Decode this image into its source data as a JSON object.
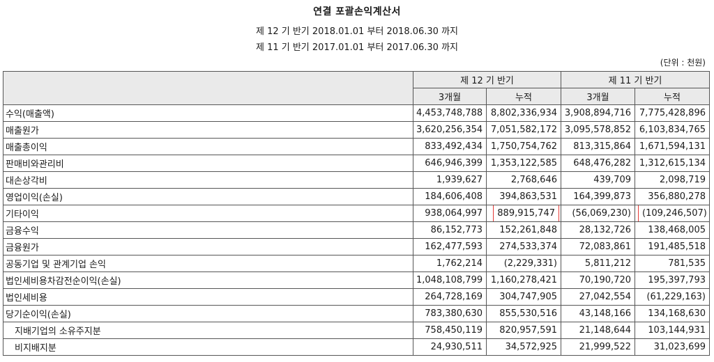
{
  "header": {
    "title": "연결 포괄손익계산서",
    "period_current": "제 12 기 반기 2018.01.01 부터 2018.06.30 까지",
    "period_prior": "제 11 기 반기 2017.01.01 부터 2017.06.30 까지",
    "unit": "(단위 : 천원)"
  },
  "table": {
    "col_groups": [
      "제 12 기 반기",
      "제 11 기 반기"
    ],
    "sub_cols": [
      "3개월",
      "누적",
      "3개월",
      "누적"
    ],
    "rows": [
      {
        "label": "수익(매출액)",
        "values": [
          "4,453,748,788",
          "8,802,336,934",
          "3,908,894,716",
          "7,775,428,896"
        ]
      },
      {
        "label": "매출원가",
        "values": [
          "3,620,256,354",
          "7,051,582,172",
          "3,095,578,852",
          "6,103,834,765"
        ]
      },
      {
        "label": "매출총이익",
        "values": [
          "833,492,434",
          "1,750,754,762",
          "813,315,864",
          "1,671,594,131"
        ]
      },
      {
        "label": "판매비와관리비",
        "values": [
          "646,946,399",
          "1,353,122,585",
          "648,476,282",
          "1,312,615,134"
        ]
      },
      {
        "label": "대손상각비",
        "values": [
          "1,939,627",
          "2,768,646",
          "439,709",
          "2,098,719"
        ]
      },
      {
        "label": "영업이익(손실)",
        "values": [
          "184,606,408",
          "394,863,531",
          "164,399,873",
          "356,880,278"
        ]
      },
      {
        "label": "기타이익",
        "values": [
          "938,064,997",
          "889,915,747",
          "(56,069,230)",
          "(109,246,507)"
        ]
      },
      {
        "label": "금융수익",
        "values": [
          "86,152,773",
          "152,261,848",
          "28,132,726",
          "138,468,005"
        ]
      },
      {
        "label": "금융원가",
        "values": [
          "162,477,593",
          "274,533,374",
          "72,083,861",
          "191,485,518"
        ]
      },
      {
        "label": "공동기업 및 관계기업 손익",
        "values": [
          "1,762,214",
          "(2,229,331)",
          "5,811,212",
          "781,535"
        ]
      },
      {
        "label": "법인세비용차감전순이익(손실)",
        "values": [
          "1,048,108,799",
          "1,160,278,421",
          "70,190,720",
          "195,397,793"
        ]
      },
      {
        "label": "법인세비용",
        "values": [
          "264,728,169",
          "304,747,905",
          "27,042,554",
          "(61,229,163)"
        ]
      },
      {
        "label": "당기순이익(손실)",
        "values": [
          "783,380,630",
          "855,530,516",
          "43,148,166",
          "134,168,630"
        ]
      },
      {
        "label": "지배기업의 소유주지분",
        "values": [
          "758,450,119",
          "820,957,591",
          "21,148,644",
          "103,144,931"
        ]
      },
      {
        "label": "비지배지분",
        "values": [
          "24,930,511",
          "34,572,925",
          "21,999,522",
          "31,023,699"
        ]
      }
    ]
  },
  "highlight_color": "#e53935"
}
